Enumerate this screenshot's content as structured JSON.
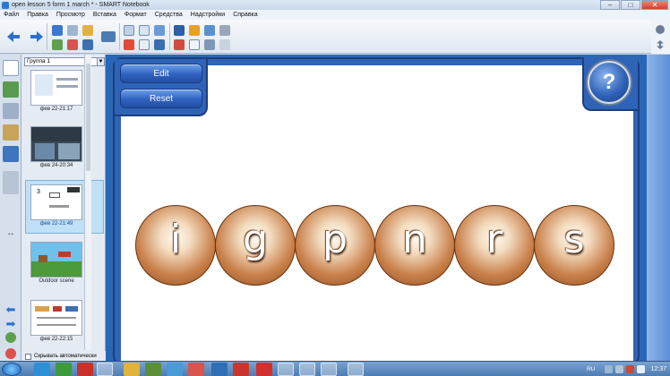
{
  "window": {
    "title": "open lesson 5 form 1 march * - SMART Notebook",
    "minimize": "–",
    "maximize": "□",
    "close": "✕"
  },
  "menu": [
    "Файл",
    "Правка",
    "Просмотр",
    "Вставка",
    "Формат",
    "Средства",
    "Надстройки",
    "Справка"
  ],
  "sorter": {
    "group": "Группа 1",
    "pages": [
      {
        "label": "фев 22-21:17"
      },
      {
        "label": "фев 24-20:34"
      },
      {
        "label": "фев 22-21:49"
      },
      {
        "label": "Outdoor scene"
      },
      {
        "label": "фев 22-22:15"
      }
    ],
    "hide_label": "Скрывать автоматически"
  },
  "lesson": {
    "edit_label": "Edit",
    "reset_label": "Reset",
    "help_label": "?",
    "letters": [
      "i",
      "g",
      "p",
      "n",
      "r",
      "s"
    ]
  },
  "taskbar": {
    "lang": "RU",
    "clock": "12:37"
  },
  "colors": {
    "frame_blue": "#2f63b8",
    "ball_brown": "#c9804a"
  }
}
